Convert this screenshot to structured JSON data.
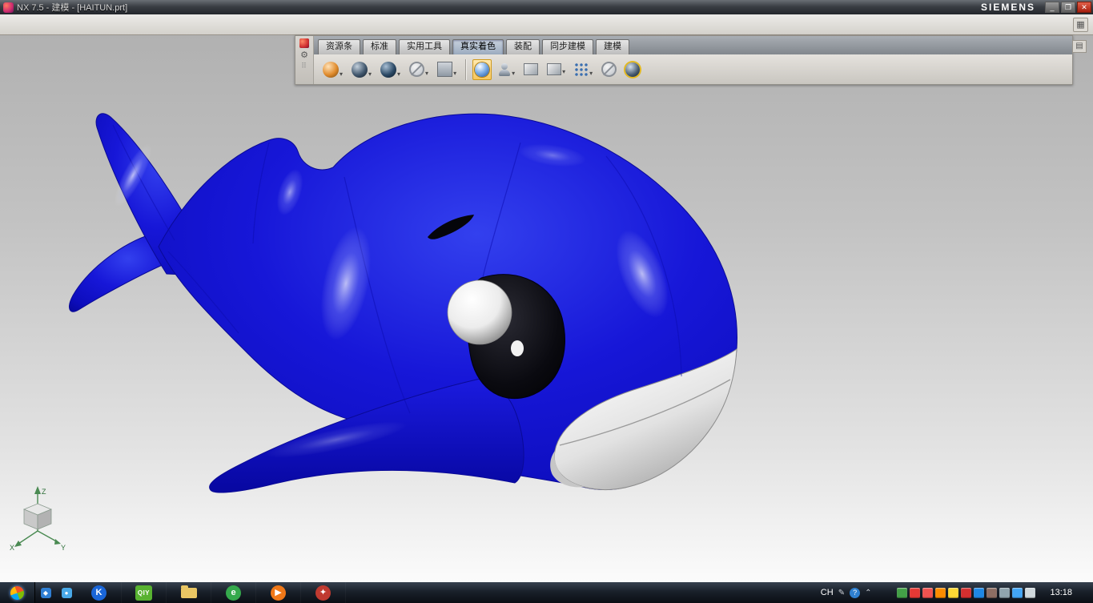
{
  "titlebar": {
    "title": "NX 7.5 - 建模 - [HAITUN.prt]",
    "brand": "SIEMENS",
    "minimize_glyph": "_",
    "restore_glyph": "❐",
    "close_glyph": "✕"
  },
  "menustrip": {
    "layout_icon_glyph": "▦"
  },
  "ribbon": {
    "caret_glyph": "▾",
    "gear_glyph": "⚙",
    "grip_glyph": "⠿",
    "dock_glyph": "▤",
    "tabs": [
      {
        "label": "资源条"
      },
      {
        "label": "标准"
      },
      {
        "label": "实用工具"
      },
      {
        "label": "真实着色"
      },
      {
        "label": "装配"
      },
      {
        "label": "同步建模"
      },
      {
        "label": "建模"
      }
    ],
    "active_tab": "真实着色",
    "icons": [
      "orient-sphere-icon",
      "rendering-style-icon",
      "shaded-style-icon",
      "visualization-off-icon",
      "background-swatch-icon",
      "true-shading-toggle-icon",
      "face-analysis-icon",
      "materials-box-icon",
      "textures-box-icon",
      "decals-dots-icon",
      "effects-off-icon",
      "global-illumination-icon"
    ]
  },
  "viewport": {
    "triad": {
      "x": "X",
      "y": "Y",
      "z": "Z"
    },
    "colors": {
      "dolphin_body": "#1616d8",
      "dolphin_shadow": "#0808a0",
      "belly_white": "#f2f2f2",
      "eye_patch": "#05050a",
      "background_top": "#b1b1b1",
      "background_bottom": "#fbfbfb"
    }
  },
  "taskbar": {
    "lang": "CH",
    "time": "13:18",
    "pen_glyph": "✎",
    "help_glyph": "?",
    "chevron_glyph": "⌃",
    "apps": [
      {
        "name": "quick-launch-1",
        "glyph": "◆",
        "color": "#2f7fd4"
      },
      {
        "name": "quick-launch-2",
        "glyph": "●",
        "color": "#49a9e8"
      },
      {
        "name": "app-icon-k",
        "glyph": "K",
        "color": "#1a66d9"
      },
      {
        "name": "app-icon-qiy",
        "glyph": "QIY",
        "color": "#58b231"
      },
      {
        "name": "folder-explorer",
        "glyph": "",
        "color": "#e9c664"
      },
      {
        "name": "browser-app",
        "glyph": "e",
        "color": "#35a94c"
      },
      {
        "name": "media-player",
        "glyph": "▶",
        "color": "#f07818"
      },
      {
        "name": "nx-app",
        "glyph": "✦",
        "color": "#c03a30"
      }
    ],
    "tray_icons": [
      {
        "color": "#43a047"
      },
      {
        "color": "#e53935"
      },
      {
        "color": "#ef5350"
      },
      {
        "color": "#fb8c00"
      },
      {
        "color": "#fdd835"
      },
      {
        "color": "#d32f2f"
      },
      {
        "color": "#1e88e5"
      },
      {
        "color": "#8d6e63"
      },
      {
        "color": "#90a4ae"
      },
      {
        "color": "#42a5f5"
      },
      {
        "color": "#cfd8dc"
      }
    ]
  }
}
